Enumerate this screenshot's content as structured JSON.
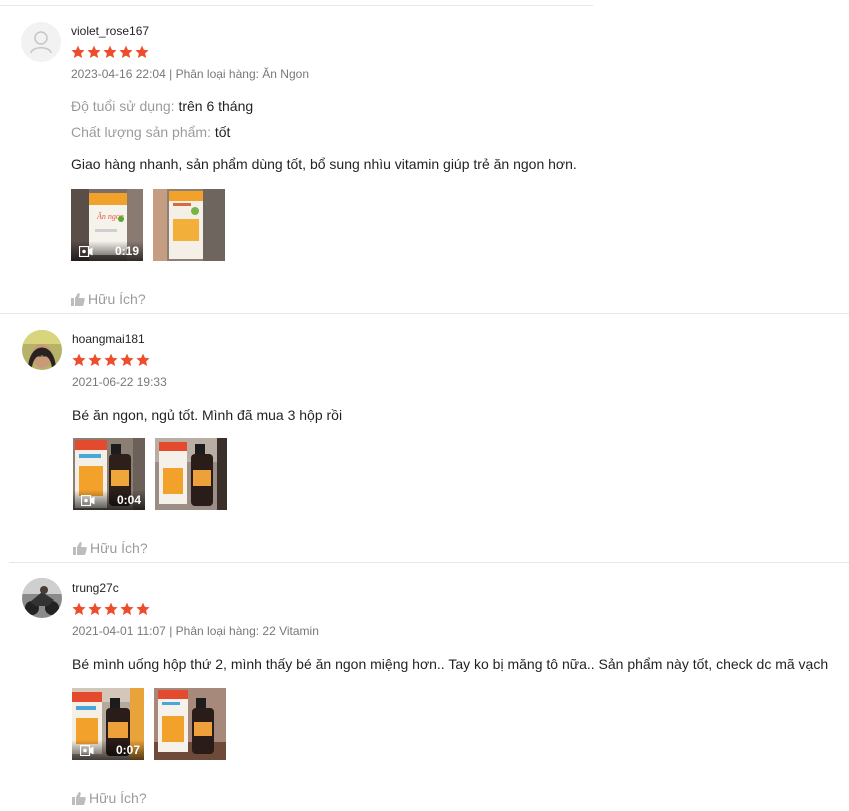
{
  "colors": {
    "star": "#ee4d2d",
    "muted": "#999999"
  },
  "reviews": [
    {
      "username": "violet_rose167",
      "stars": 5,
      "date": "2023-04-16 22:04",
      "separator": "|",
      "variation": "Phân loại hàng: Ăn Ngon",
      "attr1_label": "Độ tuổi sử dụng:",
      "attr1_value": "trên 6 tháng",
      "attr2_label": "Chất lượng sản phẩm:",
      "attr2_value": "tốt",
      "comment": "Giao hàng nhanh, sản phẩm dùng tốt, bổ sung nhìu vitamin giúp trẻ ăn ngon hơn.",
      "video_duration": "0:19",
      "helpful": "Hữu Ích?"
    },
    {
      "username": "hoangmai181",
      "stars": 5,
      "date": "2021-06-22 19:33",
      "comment": "Bé ăn ngon, ngủ tốt. Mình đã mua 3 hộp rồi",
      "video_duration": "0:04",
      "helpful": "Hữu Ích?"
    },
    {
      "username": "trung27c",
      "stars": 5,
      "date": "2021-04-01 11:07",
      "separator": "|",
      "variation": "Phân loại hàng: 22 Vitamin",
      "comment": "Bé mình uống hộp thứ 2, mình thấy bé ăn ngon miệng hơn.. Tay ko bị măng tô nữa.. Sản phẩm này tốt, check dc mã vạch",
      "video_duration": "0:07",
      "helpful": "Hữu Ích?"
    }
  ]
}
